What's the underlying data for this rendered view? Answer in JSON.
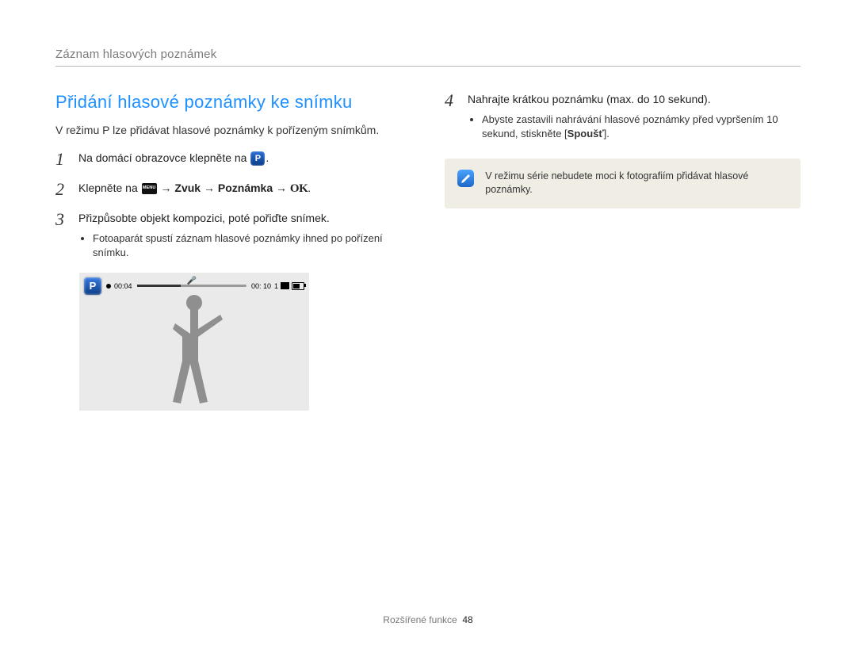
{
  "section_header": "Záznam hlasových poznámek",
  "subtitle": "Přidání hlasové poznámky ke snímku",
  "intro": "V režimu P lze přidávat hlasové poznámky k pořízeným snímkům.",
  "steps": {
    "s1": {
      "num": "1",
      "pre": "Na domácí obrazovce klepněte na ",
      "post": "."
    },
    "s2": {
      "num": "2",
      "pre": "Klepněte na ",
      "arrow": " → ",
      "zvuk": "Zvuk",
      "poznamka": "Poznámka",
      "ok": "."
    },
    "s3": {
      "num": "3",
      "text": "Přizpůsobte objekt kompozici, poté pořiďte snímek.",
      "bullet": "Fotoaparát spustí záznam hlasové poznámky ihned po pořízení snímku."
    },
    "s4": {
      "num": "4",
      "text": "Nahrajte krátkou poznámku (max. do 10 sekund).",
      "bullet_pre": "Abyste zastavili nahrávání hlasové poznámky před vypršením 10 sekund, stiskněte [",
      "bullet_b": "Spoušť",
      "bullet_post": "]."
    }
  },
  "osd": {
    "elapsed": "00:04",
    "total": "00: 10",
    "count": "1"
  },
  "note": "V režimu série nebudete moci k fotografiím přidávat hlasové poznámky.",
  "footer_label": "Rozšířené funkce",
  "footer_page": "48",
  "glyphs": {
    "p": "P",
    "menu": "MENU",
    "ok": "OK",
    "mic": "🎤",
    "pencil": "✎"
  }
}
